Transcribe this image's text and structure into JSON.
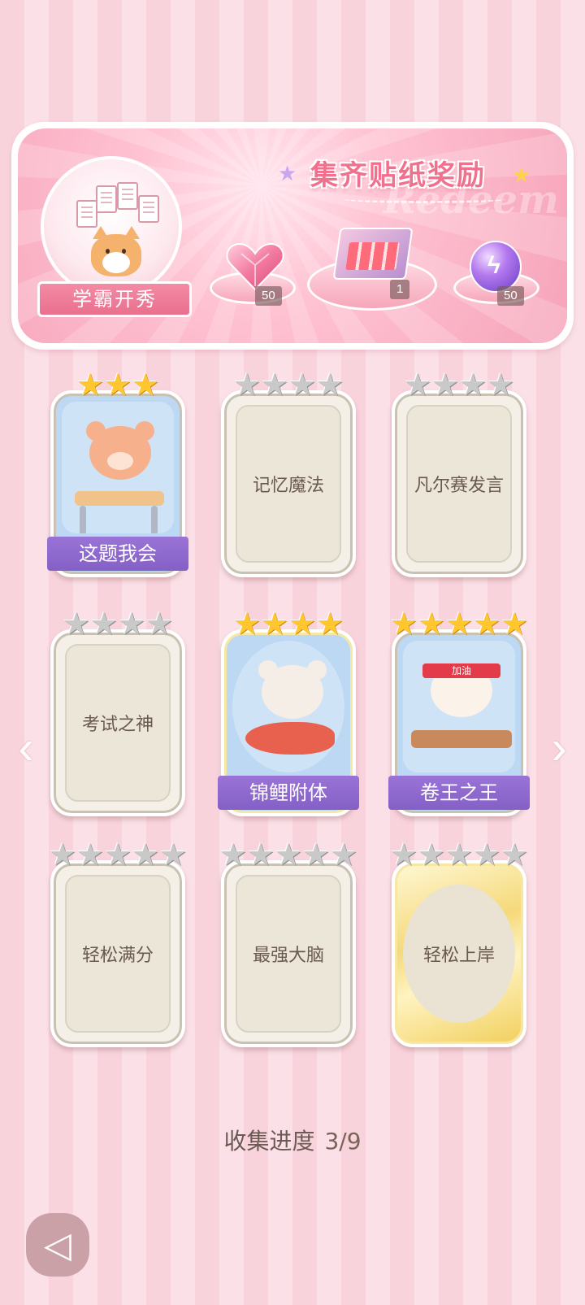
{
  "banner": {
    "title": "集齐贴纸奖励",
    "ghost_text": "Redeem",
    "badge_label": "学霸开秀",
    "rewards": [
      {
        "icon": "pink-heart-gem-icon",
        "count": "50"
      },
      {
        "icon": "gift-box-icon",
        "count": "1"
      },
      {
        "icon": "purple-lightning-orb-icon",
        "count": "50"
      }
    ]
  },
  "stickers": [
    {
      "name": "这题我会",
      "stars": 3,
      "max_stars": 3,
      "collected": true
    },
    {
      "name": "记忆魔法",
      "stars": 0,
      "max_stars": 4,
      "collected": false
    },
    {
      "name": "凡尔赛发言",
      "stars": 0,
      "max_stars": 4,
      "collected": false
    },
    {
      "name": "考试之神",
      "stars": 0,
      "max_stars": 4,
      "collected": false
    },
    {
      "name": "锦鲤附体",
      "stars": 4,
      "max_stars": 4,
      "collected": true
    },
    {
      "name": "卷王之王",
      "stars": 5,
      "max_stars": 5,
      "collected": true,
      "headband": "加油"
    },
    {
      "name": "轻松满分",
      "stars": 0,
      "max_stars": 5,
      "collected": false
    },
    {
      "name": "最强大脑",
      "stars": 0,
      "max_stars": 5,
      "collected": false
    },
    {
      "name": "轻松上岸",
      "stars": 0,
      "max_stars": 5,
      "collected": false
    }
  ],
  "progress": {
    "label": "收集进度",
    "value": "3/9"
  },
  "colors": {
    "accent_pink": "#f0708e",
    "label_purple": "#8b66cc",
    "star_gold": "#ffc62e"
  }
}
